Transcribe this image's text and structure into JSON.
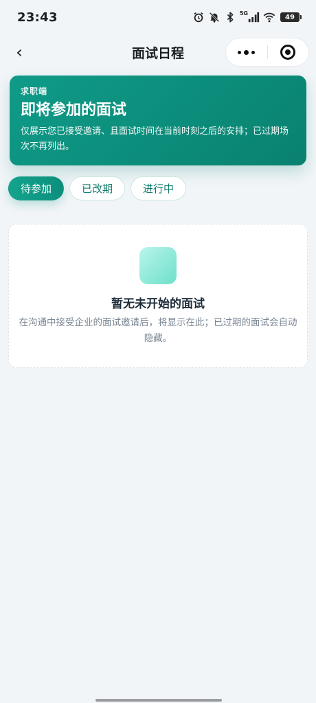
{
  "status_bar": {
    "time": "23:43",
    "network": "5G",
    "battery": "49",
    "icons": [
      "alarm-icon",
      "mute-icon",
      "bluetooth-icon",
      "signal-icon",
      "wifi-icon",
      "battery-icon"
    ]
  },
  "nav": {
    "back_glyph": "‹",
    "title": "面试日程",
    "more_icon": "more-dots-icon",
    "close_icon": "target-icon"
  },
  "hero": {
    "eyebrow": "求职端",
    "title": "即将参加的面试",
    "description": "仅展示您已接受邀请、且面试时间在当前时刻之后的安排；已过期场次不再列出。"
  },
  "tabs": [
    {
      "label": "待参加",
      "active": true
    },
    {
      "label": "已改期",
      "active": false
    },
    {
      "label": "进行中",
      "active": false
    }
  ],
  "empty_state": {
    "title": "暂无未开始的面试",
    "description": "在沟通中接受企业的面试邀请后，将显示在此；已过期的面试会自动隐藏。"
  },
  "colors": {
    "accent": "#0f9b88",
    "page_bg": "#f2f5f8"
  }
}
